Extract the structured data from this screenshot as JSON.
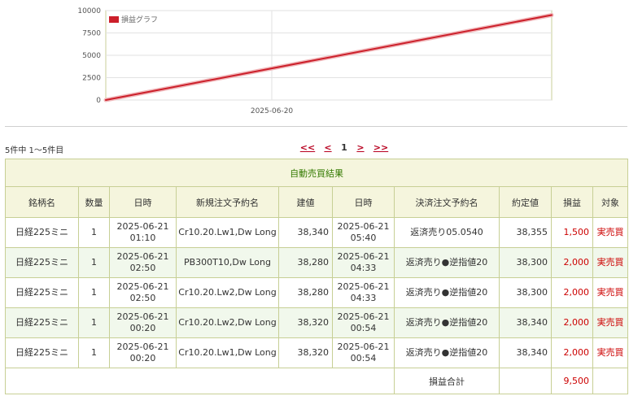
{
  "chart_data": {
    "type": "line",
    "legend": "損益グラフ",
    "x_tick_labels": [
      "2025-06-20"
    ],
    "yticks": [
      0,
      2500,
      5000,
      7500,
      10000
    ],
    "ylim": [
      0,
      10000
    ],
    "series": [
      {
        "name": "損益グラフ",
        "color": "#cc1f2a",
        "points": [
          0,
          9500
        ]
      }
    ],
    "grid": true,
    "legend_position": "top-left"
  },
  "pager": {
    "count_text": "5件中 1〜5件目",
    "first": "<<",
    "prev": "<",
    "current": "1",
    "next": ">",
    "last": ">>"
  },
  "table": {
    "title": "自動売買結果",
    "headers": [
      "銘柄名",
      "数量",
      "日時",
      "新規注文予約名",
      "建値",
      "日時",
      "決済注文予約名",
      "約定値",
      "損益",
      "対象"
    ],
    "rows": [
      {
        "name": "日経225ミニ",
        "qty": "1",
        "date1": "2025-06-21",
        "time1": "01:10",
        "order": "Cr10.20.Lw1,Dw Long",
        "entry": "38,340",
        "date2": "2025-06-21",
        "time2": "05:40",
        "settle": "返済売り05.0540",
        "exec": "38,355",
        "pl": "1,500",
        "target": "実売買"
      },
      {
        "name": "日経225ミニ",
        "qty": "1",
        "date1": "2025-06-21",
        "time1": "02:50",
        "order": "PB300T10,Dw Long",
        "entry": "38,280",
        "date2": "2025-06-21",
        "time2": "04:33",
        "settle": "返済売り●逆指値20",
        "exec": "38,300",
        "pl": "2,000",
        "target": "実売買"
      },
      {
        "name": "日経225ミニ",
        "qty": "1",
        "date1": "2025-06-21",
        "time1": "02:50",
        "order": "Cr10.20.Lw2,Dw Long",
        "entry": "38,280",
        "date2": "2025-06-21",
        "time2": "04:33",
        "settle": "返済売り●逆指値20",
        "exec": "38,300",
        "pl": "2,000",
        "target": "実売買"
      },
      {
        "name": "日経225ミニ",
        "qty": "1",
        "date1": "2025-06-21",
        "time1": "00:20",
        "order": "Cr10.20.Lw2,Dw Long",
        "entry": "38,320",
        "date2": "2025-06-21",
        "time2": "00:54",
        "settle": "返済売り●逆指値20",
        "exec": "38,340",
        "pl": "2,000",
        "target": "実売買"
      },
      {
        "name": "日経225ミニ",
        "qty": "1",
        "date1": "2025-06-21",
        "time1": "00:20",
        "order": "Cr10.20.Lw1,Dw Long",
        "entry": "38,320",
        "date2": "2025-06-21",
        "time2": "00:54",
        "settle": "返済売り●逆指値20",
        "exec": "38,340",
        "pl": "2,000",
        "target": "実売買"
      }
    ],
    "total_label": "損益合計",
    "total_value": "9,500"
  },
  "colors": {
    "accent_red": "#cc0000",
    "header_green": "#337a00",
    "border": "#c7cf95",
    "header_bg": "#f5f5dd",
    "row_alt_bg": "#f1f8ec"
  }
}
